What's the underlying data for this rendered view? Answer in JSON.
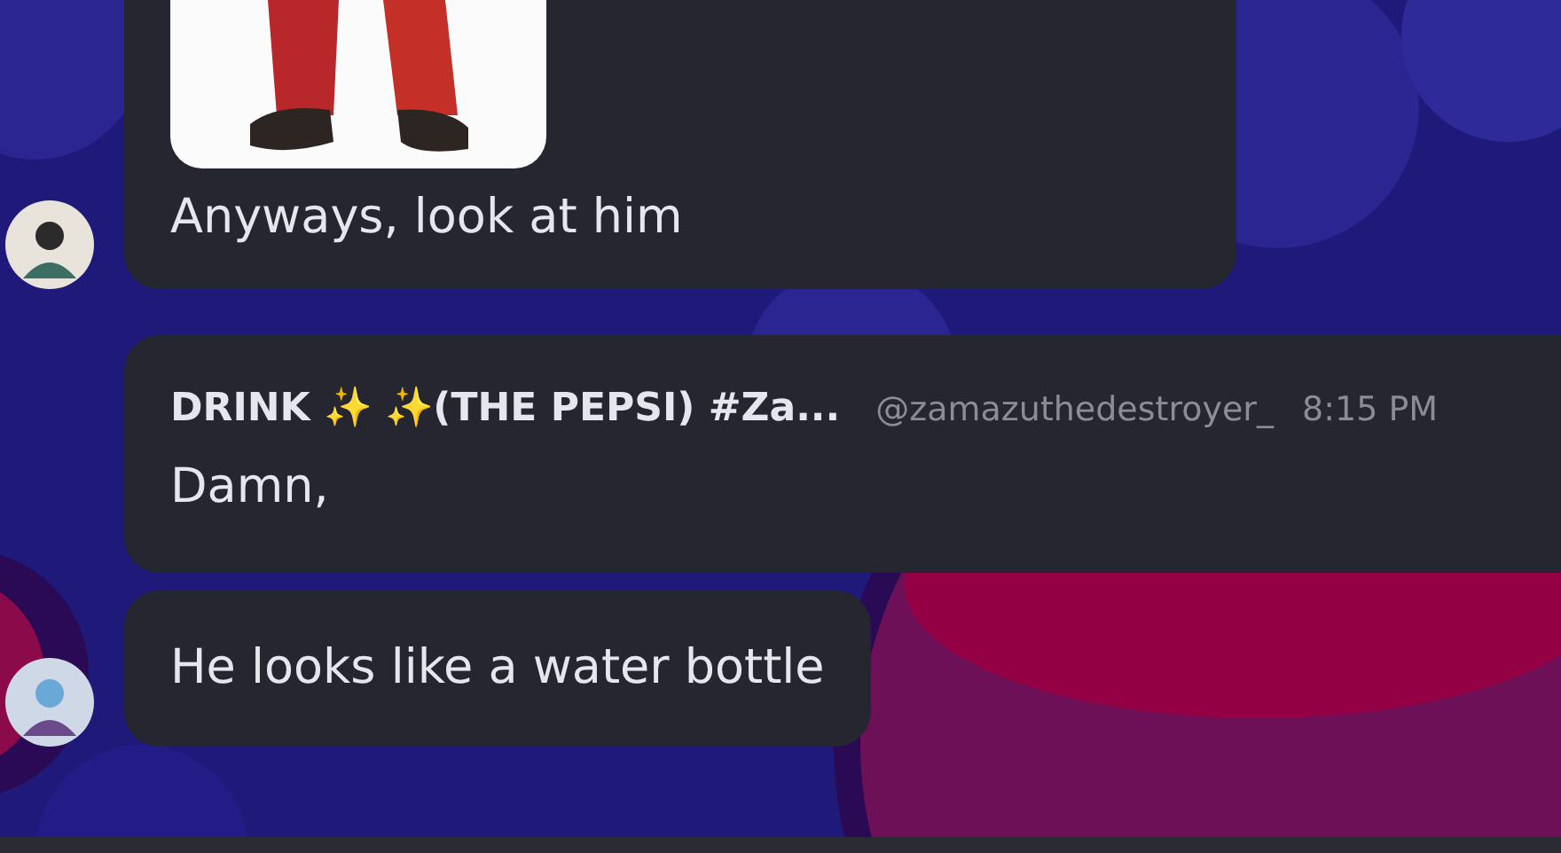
{
  "messages": [
    {
      "avatar": true,
      "text": "Anyways, look at him"
    },
    {
      "kind": "header",
      "avatar": false,
      "author": "DRINK ✨ ✨(THE PEPSI) #Za...",
      "handle": "@zamazuthedestroyer_",
      "time": "8:15 PM",
      "text": "Damn,"
    },
    {
      "kind": "plain",
      "avatar": true,
      "text": "He looks like a water bottle"
    }
  ]
}
